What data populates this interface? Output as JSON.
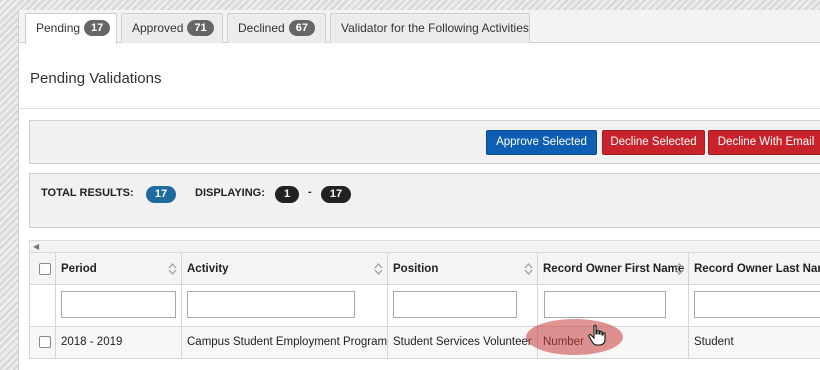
{
  "tabs": [
    {
      "label": "Pending",
      "count": "17",
      "active": true
    },
    {
      "label": "Approved",
      "count": "71",
      "active": false
    },
    {
      "label": "Declined",
      "count": "67",
      "active": false
    },
    {
      "label": "Validator for the Following Activities",
      "count": null,
      "active": false
    }
  ],
  "page_title": "Pending Validations",
  "actions": {
    "approve_label": "Approve Selected",
    "decline_label": "Decline Selected",
    "decline_email_label": "Decline With Email"
  },
  "results": {
    "total_label": "TOTAL RESULTS:",
    "total": "17",
    "displaying_label": "DISPLAYING:",
    "from": "1",
    "separator": "-",
    "to": "17"
  },
  "table": {
    "columns": [
      "Period",
      "Activity",
      "Position",
      "Record Owner First Name",
      "Record Owner Last Name"
    ],
    "rows": [
      [
        "2018 - 2019",
        "Campus Student Employment Program",
        "Student Services Volunteer",
        "Number",
        "Student"
      ]
    ]
  },
  "colors": {
    "approve": "#0e5fb4",
    "decline": "#c8232b",
    "total_pill": "#1f6b9c",
    "display_pill": "#222222",
    "tab_badge": "#666666"
  }
}
